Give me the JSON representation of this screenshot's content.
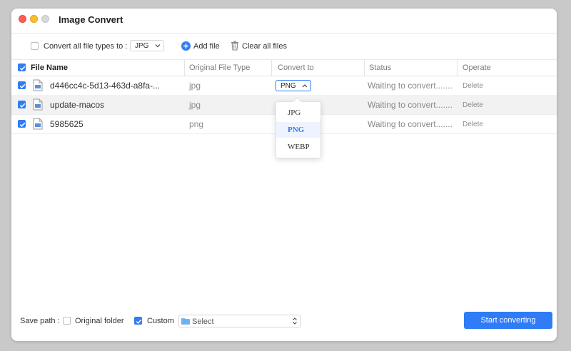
{
  "window": {
    "title": "Image Convert"
  },
  "toolbar": {
    "convert_all_label": "Convert all file types to :",
    "convert_all_value": "JPG",
    "add_file_label": "Add file",
    "clear_all_label": "Clear all files"
  },
  "table": {
    "headers": [
      "File Name",
      "Original File Type",
      "Convert to",
      "Status",
      "Operate"
    ],
    "rows": [
      {
        "name": "d446cc4c-5d13-463d-a8fa-...",
        "type": "jpg",
        "convert_to": "PNG",
        "status": "Waiting to convert.......",
        "operate": "Delete",
        "checked": true
      },
      {
        "name": "update-macos",
        "type": "jpg",
        "convert_to": "",
        "status": "Waiting to convert.......",
        "operate": "Delete",
        "checked": true
      },
      {
        "name": "5985625",
        "type": "png",
        "convert_to": "",
        "status": "Waiting to convert.......",
        "operate": "Delete",
        "checked": true
      }
    ]
  },
  "dropdown": {
    "options": [
      "JPG",
      "PNG",
      "WEBP"
    ],
    "selected": "PNG"
  },
  "footer": {
    "save_path_label": "Save path :",
    "original_folder_label": "Original folder",
    "custom_label": "Custom",
    "folder_placeholder": "Select",
    "start_button": "Start converting"
  },
  "colors": {
    "accent": "#2f7cf6",
    "close": "#ff5f57",
    "minimize": "#febc2e"
  }
}
